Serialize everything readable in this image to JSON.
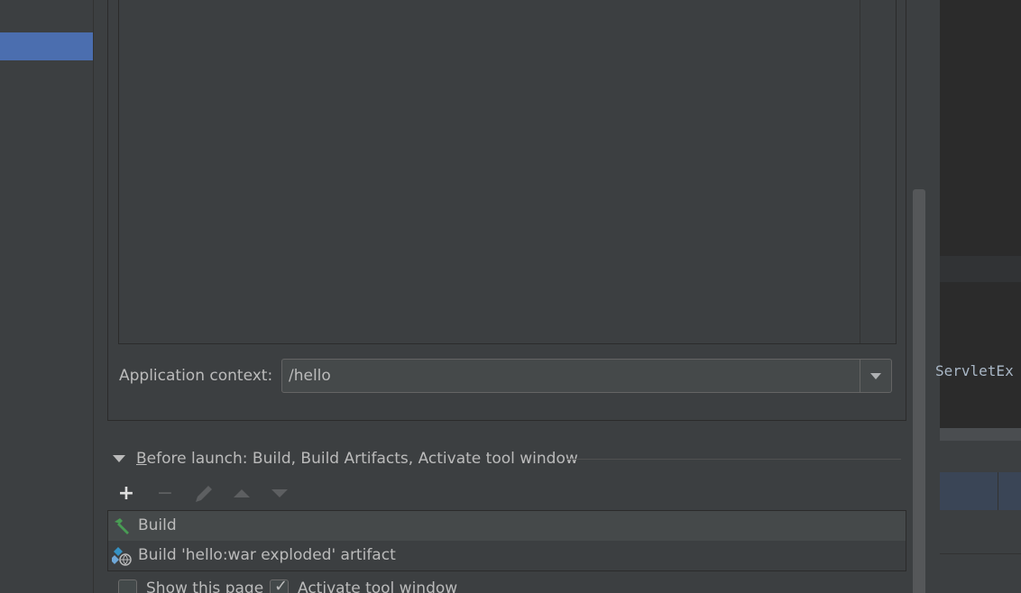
{
  "deployment": {
    "context_label": "Application context:",
    "context_value": "/hello"
  },
  "before_launch": {
    "title_mnemonic": "B",
    "title_rest": "efore launch: Build, Build Artifacts, Activate tool window",
    "toolbar": {
      "add": "+",
      "remove": "−"
    },
    "tasks": [
      {
        "label": "Build",
        "icon": "hammer-icon"
      },
      {
        "label": "Build 'hello:war exploded' artifact",
        "icon": "artifact-icon"
      }
    ],
    "show_page_label": "Show this page",
    "activate_label": "Activate tool window",
    "show_page_checked": false,
    "activate_checked": true
  },
  "editor": {
    "code_fragment": "ServletEx"
  },
  "colors": {
    "selection": "#4b6eaf",
    "background": "#3c3f41",
    "build_green": "#499c54",
    "artifact_blue": "#3592c4"
  }
}
